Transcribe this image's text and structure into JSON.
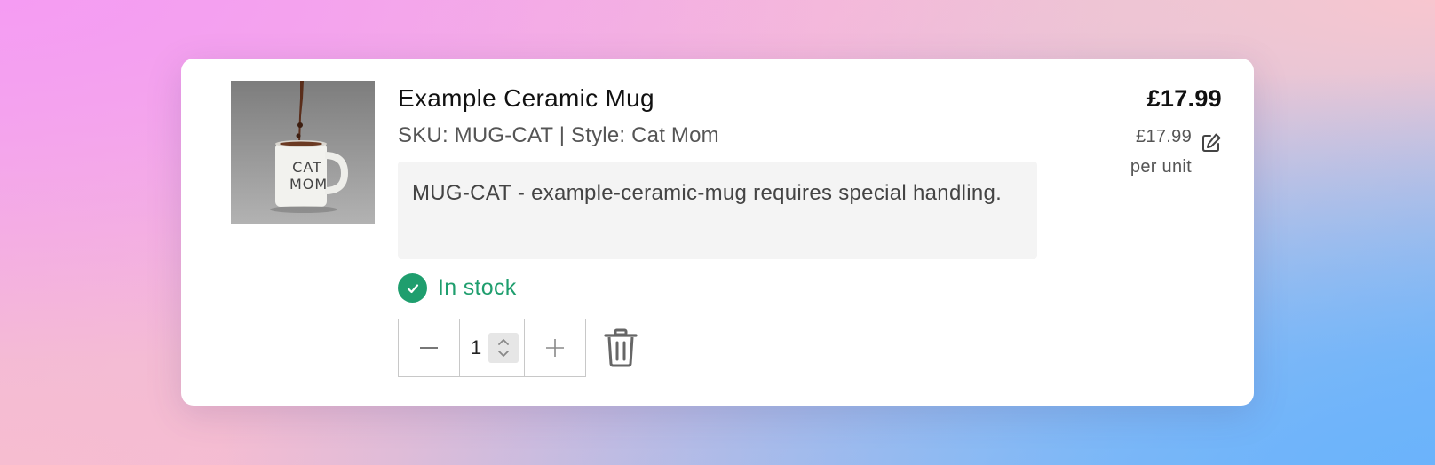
{
  "product": {
    "title": "Example Ceramic Mug",
    "meta": "SKU: MUG-CAT | Style: Cat Mom",
    "note": "MUG-CAT - example-ceramic-mug requires special handling.",
    "image_text_line1": "CAT",
    "image_text_line2": "MOM"
  },
  "stock": {
    "label": "In stock",
    "color": "#1f9e6e",
    "icon": "check-circle-icon"
  },
  "quantity": {
    "value": "1",
    "decrement_icon": "minus-icon",
    "increment_icon": "plus-icon",
    "remove_icon": "trash-icon"
  },
  "pricing": {
    "total": "£17.99",
    "unit_price": "£17.99",
    "unit_label": "per unit",
    "edit_icon": "pencil-square-icon"
  }
}
